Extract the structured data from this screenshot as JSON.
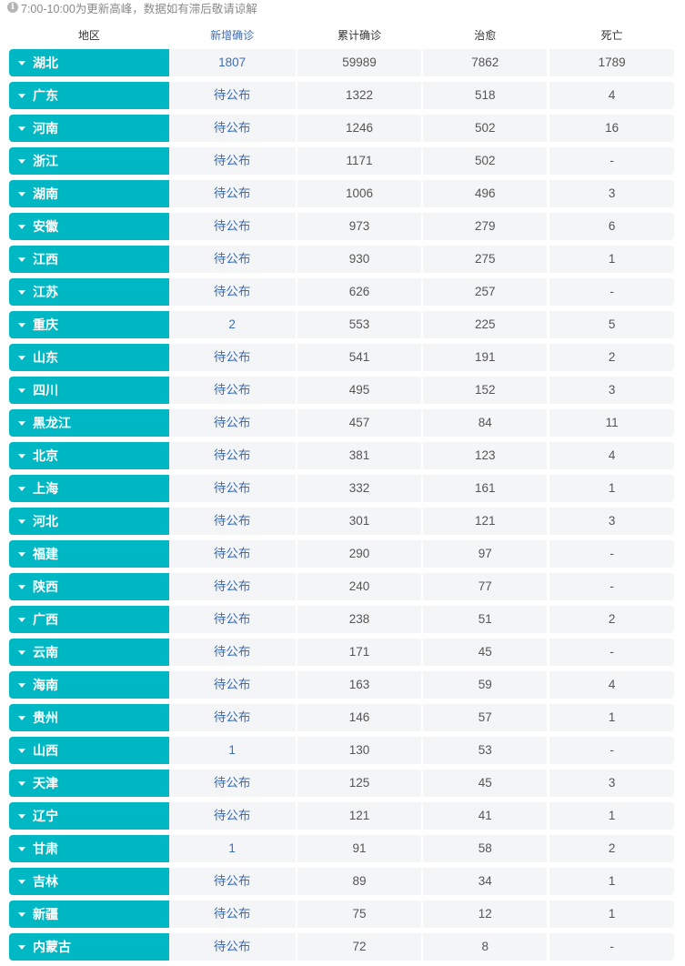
{
  "notice": {
    "icon": "info-icon",
    "text": "7:00-10:00为更新高峰，数据如有滞后敬请谅解"
  },
  "table": {
    "headers": {
      "region": "地区",
      "new_confirmed": "新增确诊",
      "total_confirmed": "累计确诊",
      "cured": "治愈",
      "dead": "死亡"
    },
    "rows": [
      {
        "region": "湖北",
        "new": "1807",
        "total": "59989",
        "cured": "7862",
        "dead": "1789"
      },
      {
        "region": "广东",
        "new": "待公布",
        "total": "1322",
        "cured": "518",
        "dead": "4"
      },
      {
        "region": "河南",
        "new": "待公布",
        "total": "1246",
        "cured": "502",
        "dead": "16"
      },
      {
        "region": "浙江",
        "new": "待公布",
        "total": "1171",
        "cured": "502",
        "dead": "-"
      },
      {
        "region": "湖南",
        "new": "待公布",
        "total": "1006",
        "cured": "496",
        "dead": "3"
      },
      {
        "region": "安徽",
        "new": "待公布",
        "total": "973",
        "cured": "279",
        "dead": "6"
      },
      {
        "region": "江西",
        "new": "待公布",
        "total": "930",
        "cured": "275",
        "dead": "1"
      },
      {
        "region": "江苏",
        "new": "待公布",
        "total": "626",
        "cured": "257",
        "dead": "-"
      },
      {
        "region": "重庆",
        "new": "2",
        "total": "553",
        "cured": "225",
        "dead": "5"
      },
      {
        "region": "山东",
        "new": "待公布",
        "total": "541",
        "cured": "191",
        "dead": "2"
      },
      {
        "region": "四川",
        "new": "待公布",
        "total": "495",
        "cured": "152",
        "dead": "3"
      },
      {
        "region": "黑龙江",
        "new": "待公布",
        "total": "457",
        "cured": "84",
        "dead": "11"
      },
      {
        "region": "北京",
        "new": "待公布",
        "total": "381",
        "cured": "123",
        "dead": "4"
      },
      {
        "region": "上海",
        "new": "待公布",
        "total": "332",
        "cured": "161",
        "dead": "1"
      },
      {
        "region": "河北",
        "new": "待公布",
        "total": "301",
        "cured": "121",
        "dead": "3"
      },
      {
        "region": "福建",
        "new": "待公布",
        "total": "290",
        "cured": "97",
        "dead": "-"
      },
      {
        "region": "陕西",
        "new": "待公布",
        "total": "240",
        "cured": "77",
        "dead": "-"
      },
      {
        "region": "广西",
        "new": "待公布",
        "total": "238",
        "cured": "51",
        "dead": "2"
      },
      {
        "region": "云南",
        "new": "待公布",
        "total": "171",
        "cured": "45",
        "dead": "-"
      },
      {
        "region": "海南",
        "new": "待公布",
        "total": "163",
        "cured": "59",
        "dead": "4"
      },
      {
        "region": "贵州",
        "new": "待公布",
        "total": "146",
        "cured": "57",
        "dead": "1"
      },
      {
        "region": "山西",
        "new": "1",
        "total": "130",
        "cured": "53",
        "dead": "-"
      },
      {
        "region": "天津",
        "new": "待公布",
        "total": "125",
        "cured": "45",
        "dead": "3"
      },
      {
        "region": "辽宁",
        "new": "待公布",
        "total": "121",
        "cured": "41",
        "dead": "1"
      },
      {
        "region": "甘肃",
        "new": "1",
        "total": "91",
        "cured": "58",
        "dead": "2"
      },
      {
        "region": "吉林",
        "new": "待公布",
        "total": "89",
        "cured": "34",
        "dead": "1"
      },
      {
        "region": "新疆",
        "new": "待公布",
        "total": "75",
        "cured": "12",
        "dead": "1"
      },
      {
        "region": "内蒙古",
        "new": "待公布",
        "total": "72",
        "cured": "8",
        "dead": "-"
      }
    ]
  },
  "colors": {
    "region_bg": "#00b8c4",
    "new_text": "#3d6db5",
    "cell_bg": "#f4f5f7"
  }
}
